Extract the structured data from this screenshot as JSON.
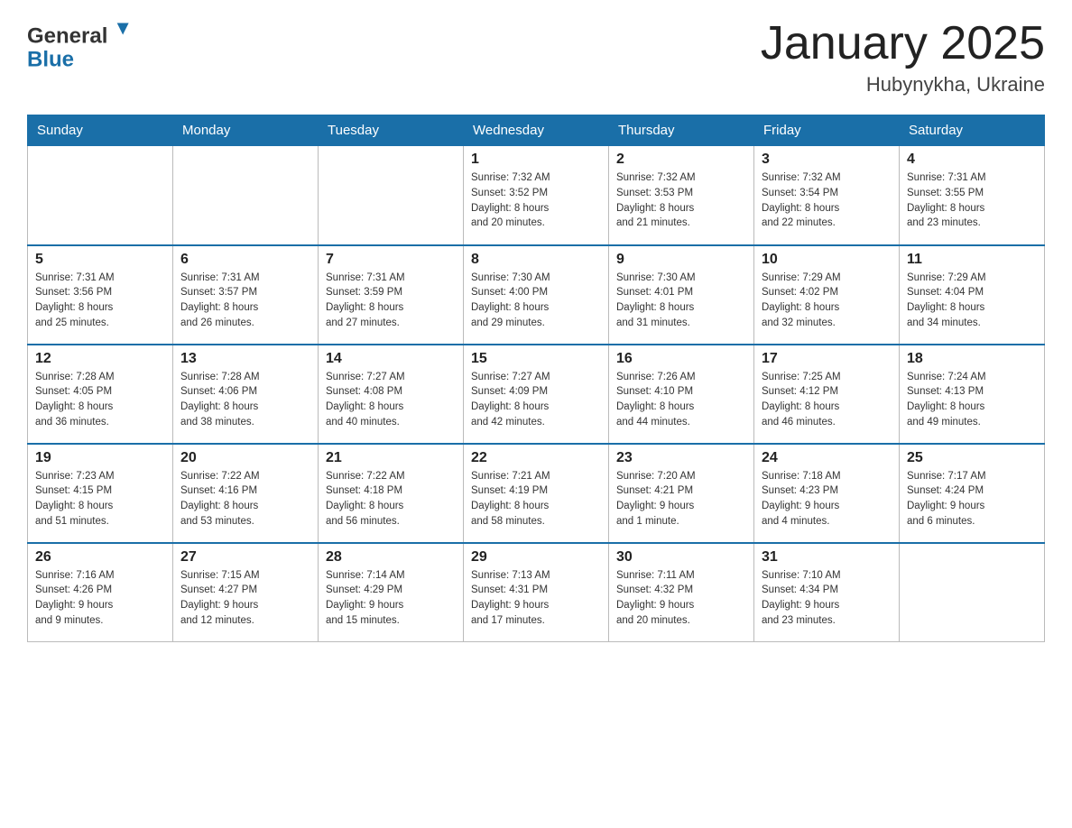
{
  "header": {
    "logo_general": "General",
    "logo_blue": "Blue",
    "month_title": "January 2025",
    "location": "Hubynykha, Ukraine"
  },
  "weekdays": [
    "Sunday",
    "Monday",
    "Tuesday",
    "Wednesday",
    "Thursday",
    "Friday",
    "Saturday"
  ],
  "weeks": [
    [
      {
        "day": "",
        "info": ""
      },
      {
        "day": "",
        "info": ""
      },
      {
        "day": "",
        "info": ""
      },
      {
        "day": "1",
        "info": "Sunrise: 7:32 AM\nSunset: 3:52 PM\nDaylight: 8 hours\nand 20 minutes."
      },
      {
        "day": "2",
        "info": "Sunrise: 7:32 AM\nSunset: 3:53 PM\nDaylight: 8 hours\nand 21 minutes."
      },
      {
        "day": "3",
        "info": "Sunrise: 7:32 AM\nSunset: 3:54 PM\nDaylight: 8 hours\nand 22 minutes."
      },
      {
        "day": "4",
        "info": "Sunrise: 7:31 AM\nSunset: 3:55 PM\nDaylight: 8 hours\nand 23 minutes."
      }
    ],
    [
      {
        "day": "5",
        "info": "Sunrise: 7:31 AM\nSunset: 3:56 PM\nDaylight: 8 hours\nand 25 minutes."
      },
      {
        "day": "6",
        "info": "Sunrise: 7:31 AM\nSunset: 3:57 PM\nDaylight: 8 hours\nand 26 minutes."
      },
      {
        "day": "7",
        "info": "Sunrise: 7:31 AM\nSunset: 3:59 PM\nDaylight: 8 hours\nand 27 minutes."
      },
      {
        "day": "8",
        "info": "Sunrise: 7:30 AM\nSunset: 4:00 PM\nDaylight: 8 hours\nand 29 minutes."
      },
      {
        "day": "9",
        "info": "Sunrise: 7:30 AM\nSunset: 4:01 PM\nDaylight: 8 hours\nand 31 minutes."
      },
      {
        "day": "10",
        "info": "Sunrise: 7:29 AM\nSunset: 4:02 PM\nDaylight: 8 hours\nand 32 minutes."
      },
      {
        "day": "11",
        "info": "Sunrise: 7:29 AM\nSunset: 4:04 PM\nDaylight: 8 hours\nand 34 minutes."
      }
    ],
    [
      {
        "day": "12",
        "info": "Sunrise: 7:28 AM\nSunset: 4:05 PM\nDaylight: 8 hours\nand 36 minutes."
      },
      {
        "day": "13",
        "info": "Sunrise: 7:28 AM\nSunset: 4:06 PM\nDaylight: 8 hours\nand 38 minutes."
      },
      {
        "day": "14",
        "info": "Sunrise: 7:27 AM\nSunset: 4:08 PM\nDaylight: 8 hours\nand 40 minutes."
      },
      {
        "day": "15",
        "info": "Sunrise: 7:27 AM\nSunset: 4:09 PM\nDaylight: 8 hours\nand 42 minutes."
      },
      {
        "day": "16",
        "info": "Sunrise: 7:26 AM\nSunset: 4:10 PM\nDaylight: 8 hours\nand 44 minutes."
      },
      {
        "day": "17",
        "info": "Sunrise: 7:25 AM\nSunset: 4:12 PM\nDaylight: 8 hours\nand 46 minutes."
      },
      {
        "day": "18",
        "info": "Sunrise: 7:24 AM\nSunset: 4:13 PM\nDaylight: 8 hours\nand 49 minutes."
      }
    ],
    [
      {
        "day": "19",
        "info": "Sunrise: 7:23 AM\nSunset: 4:15 PM\nDaylight: 8 hours\nand 51 minutes."
      },
      {
        "day": "20",
        "info": "Sunrise: 7:22 AM\nSunset: 4:16 PM\nDaylight: 8 hours\nand 53 minutes."
      },
      {
        "day": "21",
        "info": "Sunrise: 7:22 AM\nSunset: 4:18 PM\nDaylight: 8 hours\nand 56 minutes."
      },
      {
        "day": "22",
        "info": "Sunrise: 7:21 AM\nSunset: 4:19 PM\nDaylight: 8 hours\nand 58 minutes."
      },
      {
        "day": "23",
        "info": "Sunrise: 7:20 AM\nSunset: 4:21 PM\nDaylight: 9 hours\nand 1 minute."
      },
      {
        "day": "24",
        "info": "Sunrise: 7:18 AM\nSunset: 4:23 PM\nDaylight: 9 hours\nand 4 minutes."
      },
      {
        "day": "25",
        "info": "Sunrise: 7:17 AM\nSunset: 4:24 PM\nDaylight: 9 hours\nand 6 minutes."
      }
    ],
    [
      {
        "day": "26",
        "info": "Sunrise: 7:16 AM\nSunset: 4:26 PM\nDaylight: 9 hours\nand 9 minutes."
      },
      {
        "day": "27",
        "info": "Sunrise: 7:15 AM\nSunset: 4:27 PM\nDaylight: 9 hours\nand 12 minutes."
      },
      {
        "day": "28",
        "info": "Sunrise: 7:14 AM\nSunset: 4:29 PM\nDaylight: 9 hours\nand 15 minutes."
      },
      {
        "day": "29",
        "info": "Sunrise: 7:13 AM\nSunset: 4:31 PM\nDaylight: 9 hours\nand 17 minutes."
      },
      {
        "day": "30",
        "info": "Sunrise: 7:11 AM\nSunset: 4:32 PM\nDaylight: 9 hours\nand 20 minutes."
      },
      {
        "day": "31",
        "info": "Sunrise: 7:10 AM\nSunset: 4:34 PM\nDaylight: 9 hours\nand 23 minutes."
      },
      {
        "day": "",
        "info": ""
      }
    ]
  ]
}
